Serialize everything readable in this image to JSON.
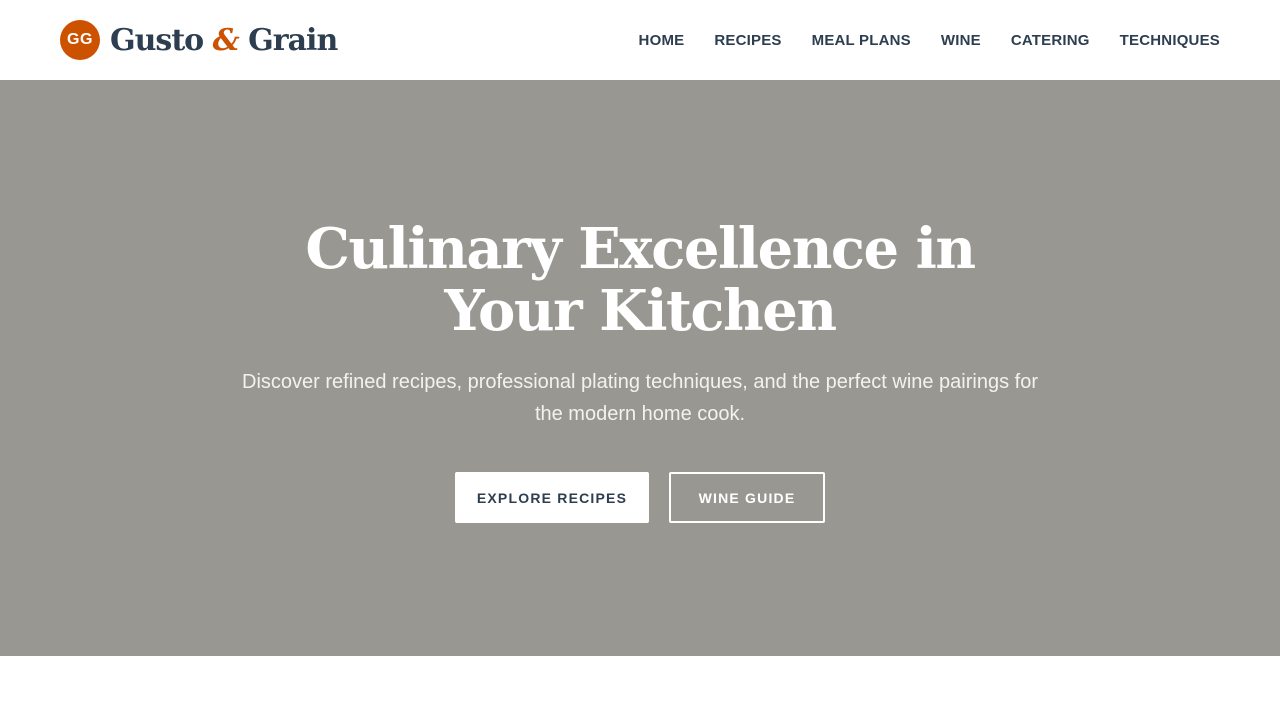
{
  "brand": {
    "badge": "GG",
    "name_part1": "Gusto ",
    "name_amp": "&",
    "name_part2": " Grain",
    "accent_color": "#cc5200",
    "text_color": "#2c3e50"
  },
  "nav": {
    "items": [
      {
        "label": "HOME"
      },
      {
        "label": "RECIPES"
      },
      {
        "label": "MEAL PLANS"
      },
      {
        "label": "WINE"
      },
      {
        "label": "CATERING"
      },
      {
        "label": "TECHNIQUES"
      }
    ]
  },
  "hero": {
    "title": "Culinary Excellence in Your Kitchen",
    "subtitle": "Discover refined recipes, professional plating techniques, and the perfect wine pairings for the modern home cook.",
    "primary_button": "EXPLORE RECIPES",
    "secondary_button": "WINE GUIDE",
    "background_color": "#989792"
  }
}
